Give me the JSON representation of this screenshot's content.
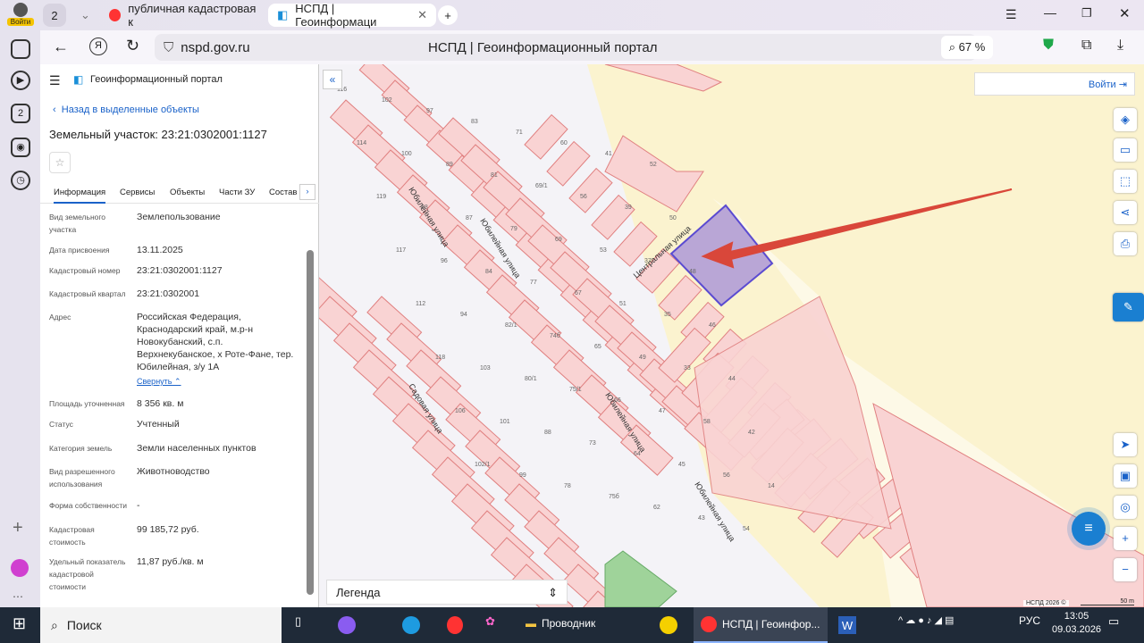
{
  "browser": {
    "login_badge": "Войти",
    "tab_count": "2",
    "tabs": [
      {
        "title": "публичная кадастровая к"
      },
      {
        "title": "НСПД | Геоинформаци"
      }
    ],
    "url": "nspd.gov.ru",
    "page_title": "НСПД | Геоинформационный портал",
    "zoom": "67 %",
    "sidebar_count": "2"
  },
  "panel": {
    "portal_title": "Геоинформационный портал",
    "back_link": "Назад в выделенные объекты",
    "object_title": "Земельный участок: 23:21:0302001:1127",
    "tabs": [
      "Информация",
      "Сервисы",
      "Объекты",
      "Части ЗУ",
      "Состав"
    ],
    "fields": [
      {
        "label": "Вид земельного участка",
        "value": "Землепользование"
      },
      {
        "label": "Дата присвоения",
        "value": "13.11.2025"
      },
      {
        "label": "Кадастровый номер",
        "value": "23:21:0302001:1127"
      },
      {
        "label": "Кадастровый квартал",
        "value": "23:21:0302001"
      },
      {
        "label": "Адрес",
        "value": "Российская Федерация, Краснодарский край, м.р-н Новокубанский, с.п. Верхнекубанское, х Роте-Фане, тер. Юбилейная, з/у 1А"
      },
      {
        "label": "Площадь уточненная",
        "value": "8 356 кв. м"
      },
      {
        "label": "Статус",
        "value": "Учтенный"
      },
      {
        "label": "Категория земель",
        "value": "Земли населенных пунктов"
      },
      {
        "label": "Вид разрешенного использования",
        "value": "Животноводство"
      },
      {
        "label": "Форма собственности",
        "value": "-"
      },
      {
        "label": "Кадастровая стоимость",
        "value": "99 185,72 руб."
      },
      {
        "label": "Удельный показатель кадастровой стоимости",
        "value": "11,87 руб./кв. м"
      }
    ],
    "collapse_link": "Свернуть"
  },
  "map": {
    "login_button": "Войти",
    "legend": "Легенда",
    "copyright": "НСПД 2026 ©",
    "scale": "50 m",
    "streets": [
      "Юбилейная улица",
      "Юбилейная улица",
      "Юбилейная улица",
      "Юбилейная улица",
      "Центральная улица",
      "Садовая улица"
    ],
    "house_numbers": [
      "116",
      "114",
      "119",
      "117",
      "112",
      "118",
      "106",
      "102/1",
      "102",
      "100",
      "98",
      "96",
      "94",
      "103",
      "101",
      "99",
      "97",
      "89",
      "87",
      "84",
      "82/1",
      "80/1",
      "88",
      "78",
      "83",
      "81",
      "79",
      "77",
      "74б",
      "75/1",
      "73",
      "75б",
      "71",
      "69/1",
      "69",
      "67",
      "65",
      "66",
      "64",
      "62",
      "60",
      "56",
      "53",
      "51",
      "49",
      "47",
      "45",
      "43",
      "41",
      "39",
      "37",
      "35",
      "33",
      "58",
      "56",
      "54",
      "52",
      "50",
      "48",
      "46",
      "44",
      "42",
      "14"
    ],
    "colors": {
      "parcel": "#f9d3d3",
      "parcel_stroke": "#e08080",
      "selected": "#b9a6d6",
      "selected_stroke": "#5b4bd1",
      "arrow": "#d9473a",
      "farmland": "#fbf3cf"
    }
  },
  "taskbar": {
    "search": "Поиск",
    "explorer": "Проводник",
    "browser_task": "НСПД | Геоинфор...",
    "lang": "РУС",
    "time": "13:05",
    "date": "09.03.2026"
  }
}
